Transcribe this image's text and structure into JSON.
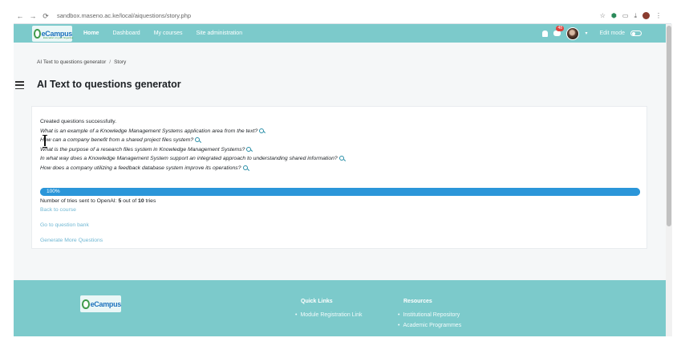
{
  "browser": {
    "url": "sandbox.maseno.ac.ke/local/aiquestions/story.php",
    "back_glyph": "←",
    "forward_glyph": "→",
    "reload_glyph": "⟳",
    "more_glyph": "⋮"
  },
  "navbar": {
    "logo_text": "eCampus",
    "logo_tagline": "Education on your fingertips",
    "links": [
      "Home",
      "Dashboard",
      "My courses",
      "Site administration"
    ],
    "active": "Home",
    "message_badge": "48",
    "edit_mode_label": "Edit mode"
  },
  "breadcrumb": {
    "items": [
      "AI Text to questions generator",
      "Story"
    ],
    "separator": "/"
  },
  "page": {
    "title": "AI Text to questions generator"
  },
  "result": {
    "status": "Created questions successfully.",
    "questions": [
      "What is an example of a Knowledge Management Systems application area from the text?",
      "How can a company benefit from a shared project files system?",
      "What is the purpose of a research files system in Knowledge Management Systems?",
      "In what way does a Knowledge Management System support an integrated approach to understanding shared information?",
      "How does a company utilizing a feedback database system improve its operations?"
    ],
    "progress_label": "100%",
    "progress_fraction": 1.0,
    "tries_prefix": "Number of tries sent to OpenAI: ",
    "tries_done": "5",
    "tries_mid": " out of ",
    "tries_total": "10",
    "tries_suffix": " tries",
    "links": {
      "back": "Back to course",
      "bank": "Go to question bank",
      "more": "Generate More Questions"
    }
  },
  "footer": {
    "logo_text": "eCampus",
    "quick_links_title": "Quick Links",
    "quick_links": [
      "Module Registration Link"
    ],
    "resources_title": "Resources",
    "resources": [
      "Institutional Repository",
      "Academic Programmes"
    ]
  },
  "colors": {
    "navbar": "#7ccacb",
    "progress": "#2b96d9",
    "link": "#6fb7d3"
  }
}
